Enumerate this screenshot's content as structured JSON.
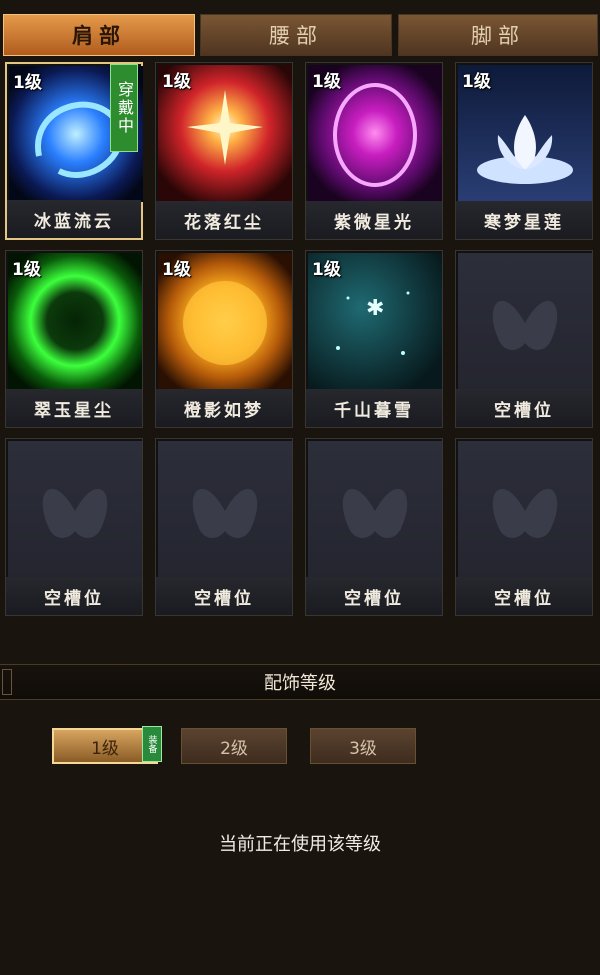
{
  "tabs": [
    {
      "label": "肩部",
      "active": true
    },
    {
      "label": "腰部",
      "active": false
    },
    {
      "label": "脚部",
      "active": false
    }
  ],
  "items": [
    {
      "name": "冰蓝流云",
      "level": "1级",
      "worn_label": "穿戴中",
      "icon": "blue-swirl-icon"
    },
    {
      "name": "花落红尘",
      "level": "1级",
      "icon": "red-burst-icon"
    },
    {
      "name": "紫微星光",
      "level": "1级",
      "icon": "purple-ring-icon"
    },
    {
      "name": "寒梦星莲",
      "level": "1级",
      "icon": "white-lotus-icon"
    },
    {
      "name": "翠玉星尘",
      "level": "1级",
      "icon": "green-ring-icon"
    },
    {
      "name": "橙影如梦",
      "level": "1级",
      "icon": "orange-sun-icon"
    },
    {
      "name": "千山暮雪",
      "level": "1级",
      "icon": "snowflake-icon"
    },
    {
      "name": "空槽位",
      "icon": "butterfly-placeholder-icon"
    },
    {
      "name": "空槽位",
      "icon": "butterfly-placeholder-icon"
    },
    {
      "name": "空槽位",
      "icon": "butterfly-placeholder-icon"
    },
    {
      "name": "空槽位",
      "icon": "butterfly-placeholder-icon"
    },
    {
      "name": "空槽位",
      "icon": "butterfly-placeholder-icon"
    }
  ],
  "section_title": "配饰等级",
  "levels": [
    {
      "label": "1级",
      "equipped_badge": "装备",
      "active": true
    },
    {
      "label": "2级",
      "active": false
    },
    {
      "label": "3级",
      "active": false
    }
  ],
  "status_text": "当前正在使用该等级",
  "colors": {
    "accent": "#e3c683",
    "worn_badge": "#2d8c2d"
  }
}
